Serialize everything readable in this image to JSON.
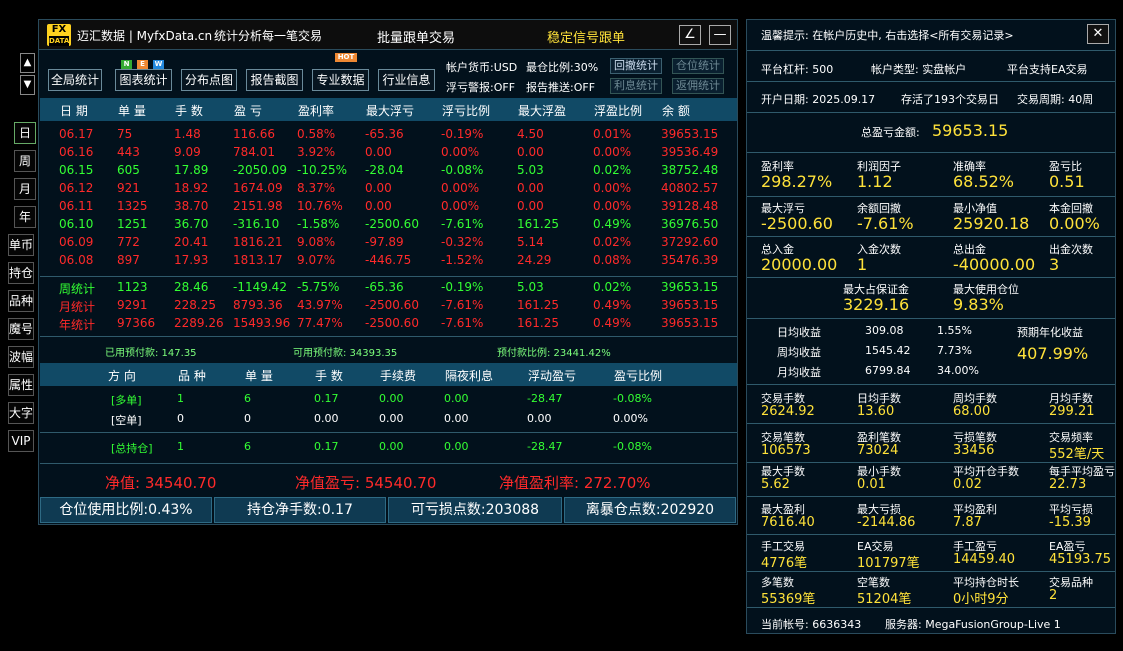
{
  "header": {
    "logo_top": "FX",
    "logo_bottom": "DATA",
    "brand": "迈汇数据 | MyfxData.cn",
    "slogan": "统计分析每一笔交易",
    "center": "批量跟单交易",
    "signal": "稳定信号跟单",
    "btn_edit": "∠",
    "btn_min": "—"
  },
  "scroll": {
    "up": "▲",
    "down": "▼"
  },
  "toolbar": {
    "global": "全局统计",
    "chart": "图表统计",
    "scatter": "分布点图",
    "report": "报告截图",
    "pro": "专业数据",
    "industry": "行业信息",
    "badge_n": "N",
    "badge_e": "E",
    "badge_w": "W",
    "badge_hot": "HOT"
  },
  "account": {
    "currency": "帐户货币:USD",
    "max_pos": "最仓比例:30%",
    "float_alert": "浮亏警报:OFF",
    "report_push": "报告推送:OFF"
  },
  "stat_btns": {
    "drawdown": "回撤统计",
    "position": "仓位统计",
    "interest": "利息统计",
    "rebate": "返佣统计"
  },
  "side_tabs": [
    "日",
    "周",
    "月",
    "年",
    "单币",
    "持仓",
    "品种",
    "魔号",
    "波幅",
    "属性",
    "大字",
    "VIP"
  ],
  "table": {
    "headers": [
      "日 期",
      "单 量",
      "手 数",
      "盈 亏",
      "盈利率",
      "最大浮亏",
      "浮亏比例",
      "最大浮盈",
      "浮盈比例",
      "余 额"
    ],
    "rows": [
      {
        "c": "red",
        "v": [
          "06.17",
          "75",
          "1.48",
          "116.66",
          "0.58%",
          "-65.36",
          "-0.19%",
          "4.50",
          "0.01%",
          "39653.15"
        ]
      },
      {
        "c": "red",
        "v": [
          "06.16",
          "443",
          "9.09",
          "784.01",
          "3.92%",
          "0.00",
          "0.00%",
          "0.00",
          "0.00%",
          "39536.49"
        ]
      },
      {
        "c": "grn",
        "v": [
          "06.15",
          "605",
          "17.89",
          "-2050.09",
          "-10.25%",
          "-28.04",
          "-0.08%",
          "5.03",
          "0.02%",
          "38752.48"
        ]
      },
      {
        "c": "red",
        "v": [
          "06.12",
          "921",
          "18.92",
          "1674.09",
          "8.37%",
          "0.00",
          "0.00%",
          "0.00",
          "0.00%",
          "40802.57"
        ]
      },
      {
        "c": "red",
        "v": [
          "06.11",
          "1325",
          "38.70",
          "2151.98",
          "10.76%",
          "0.00",
          "0.00%",
          "0.00",
          "0.00%",
          "39128.48"
        ]
      },
      {
        "c": "grn",
        "v": [
          "06.10",
          "1251",
          "36.70",
          "-316.10",
          "-1.58%",
          "-2500.60",
          "-7.61%",
          "161.25",
          "0.49%",
          "36976.50"
        ]
      },
      {
        "c": "red",
        "v": [
          "06.09",
          "772",
          "20.41",
          "1816.21",
          "9.08%",
          "-97.89",
          "-0.32%",
          "5.14",
          "0.02%",
          "37292.60"
        ]
      },
      {
        "c": "red",
        "v": [
          "06.08",
          "897",
          "17.93",
          "1813.17",
          "9.07%",
          "-446.75",
          "-1.52%",
          "24.29",
          "0.08%",
          "35476.39"
        ]
      }
    ],
    "summary": [
      {
        "c": "grn",
        "v": [
          "周统计",
          "1123",
          "28.46",
          "-1149.42",
          "-5.75%",
          "-65.36",
          "-0.19%",
          "5.03",
          "0.02%",
          "39653.15"
        ]
      },
      {
        "c": "red",
        "v": [
          "月统计",
          "9291",
          "228.25",
          "8793.36",
          "43.97%",
          "-2500.60",
          "-7.61%",
          "161.25",
          "0.49%",
          "39653.15"
        ]
      },
      {
        "c": "red",
        "v": [
          "年统计",
          "97366",
          "2289.26",
          "15493.96",
          "77.47%",
          "-2500.60",
          "-7.61%",
          "161.25",
          "0.49%",
          "39653.15"
        ]
      }
    ]
  },
  "margin": {
    "used": "已用预付款: 147.35",
    "avail": "可用预付款: 34393.35",
    "ratio": "预付款比例: 23441.42%"
  },
  "positions": {
    "headers": [
      "方 向",
      "品 种",
      "单 量",
      "手 数",
      "手续费",
      "隔夜利息",
      "浮动盈亏",
      "盈亏比例"
    ],
    "rows": [
      {
        "c": "grn",
        "v": [
          "[多单]",
          "1",
          "6",
          "0.17",
          "0.00",
          "0.00",
          "-28.47",
          "-0.08%"
        ]
      },
      {
        "c": "wht",
        "v": [
          "[空单]",
          "0",
          "0",
          "0.00",
          "0.00",
          "0.00",
          "0.00",
          "0.00%"
        ]
      },
      {
        "c": "grn",
        "v": [
          "[总持仓]",
          "1",
          "6",
          "0.17",
          "0.00",
          "0.00",
          "-28.47",
          "-0.08%"
        ]
      }
    ]
  },
  "equity": {
    "net": "净值: 34540.70",
    "pnl": "净值盈亏: 54540.70",
    "rate": "净值盈利率: 272.70%"
  },
  "bottom": {
    "usage": "仓位使用比例:0.43%",
    "net_lots": "持仓净手数:0.17",
    "loss_pts": "可亏损点数:203088",
    "liq_pts": "离暴仓点数:202920"
  },
  "right": {
    "tip": "温馨提示: 在帐户历史中, 右击选择<所有交易记录>",
    "close": "✕",
    "leverage": "平台杠杆: 500",
    "acct_type": "帐户类型: 实盘帐户",
    "ea": "平台支持EA交易",
    "open_date": "开户日期: 2025.09.17",
    "days": "存活了193个交易日",
    "period": "交易周期: 40周",
    "total_label": "总盈亏金额:",
    "total_value": "59653.15",
    "g1": [
      [
        "盈利率",
        "298.27%"
      ],
      [
        "利润因子",
        "1.12"
      ],
      [
        "准确率",
        "68.52%"
      ],
      [
        "盈亏比",
        "0.51"
      ]
    ],
    "g2": [
      [
        "最大浮亏",
        "-2500.60"
      ],
      [
        "余额回撤",
        "-7.61%"
      ],
      [
        "最小净值",
        "25920.18"
      ],
      [
        "本金回撤",
        "0.00%"
      ]
    ],
    "g3": [
      [
        "总入金",
        "20000.00"
      ],
      [
        "入金次数",
        "1"
      ],
      [
        "总出金",
        "-40000.00"
      ],
      [
        "出金次数",
        "3"
      ]
    ],
    "g4": [
      [
        "最大占保证金",
        "3229.16"
      ],
      [
        "最大使用仓位",
        "9.83%"
      ]
    ],
    "avg": [
      [
        "日均收益",
        "309.08",
        "1.55%"
      ],
      [
        "周均收益",
        "1545.42",
        "7.73%"
      ],
      [
        "月均收益",
        "6799.84",
        "34.00%"
      ]
    ],
    "annual_label": "预期年化收益",
    "annual_value": "407.99%",
    "s1": [
      [
        "交易手数",
        "2624.92"
      ],
      [
        "日均手数",
        "13.60"
      ],
      [
        "周均手数",
        "68.00"
      ],
      [
        "月均手数",
        "299.21"
      ]
    ],
    "s2": [
      [
        "交易笔数",
        "106573"
      ],
      [
        "盈利笔数",
        "73024"
      ],
      [
        "亏损笔数",
        "33456"
      ],
      [
        "交易频率",
        "552笔/天"
      ]
    ],
    "s3": [
      [
        "最大手数",
        "5.62"
      ],
      [
        "最小手数",
        "0.01"
      ],
      [
        "平均开仓手数",
        "0.02"
      ],
      [
        "每手平均盈亏",
        "22.73"
      ]
    ],
    "s4": [
      [
        "最大盈利",
        "7616.40"
      ],
      [
        "最大亏损",
        "-2144.86"
      ],
      [
        "平均盈利",
        "7.87"
      ],
      [
        "平均亏损",
        "-15.39"
      ]
    ],
    "s5": [
      [
        "手工交易",
        "4776笔"
      ],
      [
        "EA交易",
        "101797笔"
      ],
      [
        "手工盈亏",
        "14459.40"
      ],
      [
        "EA盈亏",
        "45193.75"
      ]
    ],
    "s6": [
      [
        "多笔数",
        "55369笔"
      ],
      [
        "空笔数",
        "51204笔"
      ],
      [
        "平均持仓时长",
        "0小时9分"
      ],
      [
        "交易品种",
        "2"
      ]
    ],
    "acct_no": "当前帐号: 6636343",
    "server": "服务器: MegaFusionGroup-Live 1"
  }
}
